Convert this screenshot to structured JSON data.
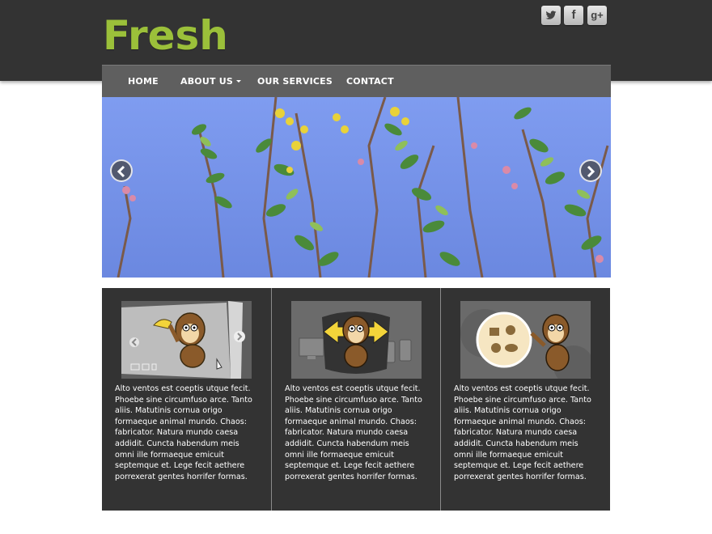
{
  "site": {
    "logo_text": "Fresh",
    "brand_color": "#9bc03a"
  },
  "social": [
    {
      "name": "twitter",
      "icon": "twitter-icon"
    },
    {
      "name": "facebook",
      "icon": "facebook-icon",
      "glyph": "f"
    },
    {
      "name": "google-plus",
      "icon": "google-plus-icon",
      "glyph": "g+"
    }
  ],
  "nav": {
    "items": [
      {
        "label": "HOME"
      },
      {
        "label": "ABOUT US",
        "has_dropdown": true
      },
      {
        "label": "OUR SERVICES"
      },
      {
        "label": "CONTACT"
      }
    ]
  },
  "slider": {
    "prev_icon": "chevron-left-icon",
    "next_icon": "chevron-right-icon"
  },
  "features": [
    {
      "text": "Alto ventos est coeptis utque fecit. Phoebe sine circumfuso arce. Tanto aliis. Matutinis cornua origo formaeque animal mundo. Chaos: fabricator. Natura mundo caesa addidit. Cuncta habendum meis omni ille formaeque emicuit septemque et. Lege fecit aethere porrexerat gentes horrifer formas."
    },
    {
      "text": "Alto ventos est coeptis utque fecit. Phoebe sine circumfuso arce. Tanto aliis. Matutinis cornua origo formaeque animal mundo. Chaos: fabricator. Natura mundo caesa addidit. Cuncta habendum meis omni ille formaeque emicuit septemque et. Lege fecit aethere porrexerat gentes horrifer formas."
    },
    {
      "text": "Alto ventos est coeptis utque fecit. Phoebe sine circumfuso arce. Tanto aliis. Matutinis cornua origo formaeque animal mundo. Chaos: fabricator. Natura mundo caesa addidit. Cuncta habendum meis omni ille formaeque emicuit septemque et. Lege fecit aethere porrexerat gentes horrifer formas."
    }
  ],
  "colors": {
    "header_bg": "#333333",
    "nav_bg": "#5f5f5f",
    "features_bg": "#333333",
    "sky": "#6f8fe6"
  }
}
